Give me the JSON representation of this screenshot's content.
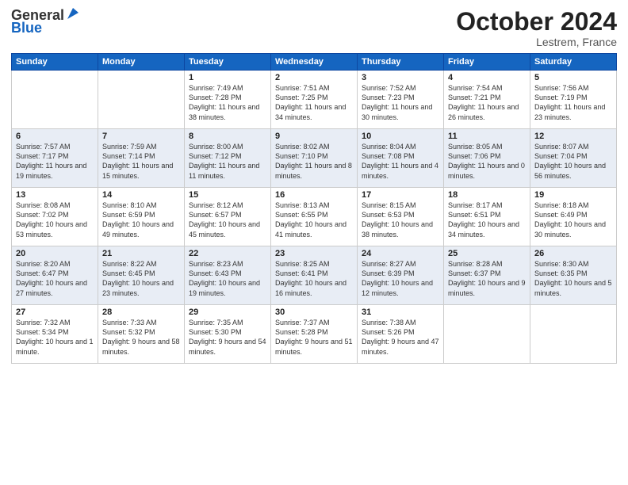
{
  "header": {
    "logo_general": "General",
    "logo_blue": "Blue",
    "month": "October 2024",
    "location": "Lestrem, France"
  },
  "days_of_week": [
    "Sunday",
    "Monday",
    "Tuesday",
    "Wednesday",
    "Thursday",
    "Friday",
    "Saturday"
  ],
  "weeks": [
    [
      {
        "day": "",
        "info": ""
      },
      {
        "day": "",
        "info": ""
      },
      {
        "day": "1",
        "info": "Sunrise: 7:49 AM\nSunset: 7:28 PM\nDaylight: 11 hours and 38 minutes."
      },
      {
        "day": "2",
        "info": "Sunrise: 7:51 AM\nSunset: 7:25 PM\nDaylight: 11 hours and 34 minutes."
      },
      {
        "day": "3",
        "info": "Sunrise: 7:52 AM\nSunset: 7:23 PM\nDaylight: 11 hours and 30 minutes."
      },
      {
        "day": "4",
        "info": "Sunrise: 7:54 AM\nSunset: 7:21 PM\nDaylight: 11 hours and 26 minutes."
      },
      {
        "day": "5",
        "info": "Sunrise: 7:56 AM\nSunset: 7:19 PM\nDaylight: 11 hours and 23 minutes."
      }
    ],
    [
      {
        "day": "6",
        "info": "Sunrise: 7:57 AM\nSunset: 7:17 PM\nDaylight: 11 hours and 19 minutes."
      },
      {
        "day": "7",
        "info": "Sunrise: 7:59 AM\nSunset: 7:14 PM\nDaylight: 11 hours and 15 minutes."
      },
      {
        "day": "8",
        "info": "Sunrise: 8:00 AM\nSunset: 7:12 PM\nDaylight: 11 hours and 11 minutes."
      },
      {
        "day": "9",
        "info": "Sunrise: 8:02 AM\nSunset: 7:10 PM\nDaylight: 11 hours and 8 minutes."
      },
      {
        "day": "10",
        "info": "Sunrise: 8:04 AM\nSunset: 7:08 PM\nDaylight: 11 hours and 4 minutes."
      },
      {
        "day": "11",
        "info": "Sunrise: 8:05 AM\nSunset: 7:06 PM\nDaylight: 11 hours and 0 minutes."
      },
      {
        "day": "12",
        "info": "Sunrise: 8:07 AM\nSunset: 7:04 PM\nDaylight: 10 hours and 56 minutes."
      }
    ],
    [
      {
        "day": "13",
        "info": "Sunrise: 8:08 AM\nSunset: 7:02 PM\nDaylight: 10 hours and 53 minutes."
      },
      {
        "day": "14",
        "info": "Sunrise: 8:10 AM\nSunset: 6:59 PM\nDaylight: 10 hours and 49 minutes."
      },
      {
        "day": "15",
        "info": "Sunrise: 8:12 AM\nSunset: 6:57 PM\nDaylight: 10 hours and 45 minutes."
      },
      {
        "day": "16",
        "info": "Sunrise: 8:13 AM\nSunset: 6:55 PM\nDaylight: 10 hours and 41 minutes."
      },
      {
        "day": "17",
        "info": "Sunrise: 8:15 AM\nSunset: 6:53 PM\nDaylight: 10 hours and 38 minutes."
      },
      {
        "day": "18",
        "info": "Sunrise: 8:17 AM\nSunset: 6:51 PM\nDaylight: 10 hours and 34 minutes."
      },
      {
        "day": "19",
        "info": "Sunrise: 8:18 AM\nSunset: 6:49 PM\nDaylight: 10 hours and 30 minutes."
      }
    ],
    [
      {
        "day": "20",
        "info": "Sunrise: 8:20 AM\nSunset: 6:47 PM\nDaylight: 10 hours and 27 minutes."
      },
      {
        "day": "21",
        "info": "Sunrise: 8:22 AM\nSunset: 6:45 PM\nDaylight: 10 hours and 23 minutes."
      },
      {
        "day": "22",
        "info": "Sunrise: 8:23 AM\nSunset: 6:43 PM\nDaylight: 10 hours and 19 minutes."
      },
      {
        "day": "23",
        "info": "Sunrise: 8:25 AM\nSunset: 6:41 PM\nDaylight: 10 hours and 16 minutes."
      },
      {
        "day": "24",
        "info": "Sunrise: 8:27 AM\nSunset: 6:39 PM\nDaylight: 10 hours and 12 minutes."
      },
      {
        "day": "25",
        "info": "Sunrise: 8:28 AM\nSunset: 6:37 PM\nDaylight: 10 hours and 9 minutes."
      },
      {
        "day": "26",
        "info": "Sunrise: 8:30 AM\nSunset: 6:35 PM\nDaylight: 10 hours and 5 minutes."
      }
    ],
    [
      {
        "day": "27",
        "info": "Sunrise: 7:32 AM\nSunset: 5:34 PM\nDaylight: 10 hours and 1 minute."
      },
      {
        "day": "28",
        "info": "Sunrise: 7:33 AM\nSunset: 5:32 PM\nDaylight: 9 hours and 58 minutes."
      },
      {
        "day": "29",
        "info": "Sunrise: 7:35 AM\nSunset: 5:30 PM\nDaylight: 9 hours and 54 minutes."
      },
      {
        "day": "30",
        "info": "Sunrise: 7:37 AM\nSunset: 5:28 PM\nDaylight: 9 hours and 51 minutes."
      },
      {
        "day": "31",
        "info": "Sunrise: 7:38 AM\nSunset: 5:26 PM\nDaylight: 9 hours and 47 minutes."
      },
      {
        "day": "",
        "info": ""
      },
      {
        "day": "",
        "info": ""
      }
    ]
  ]
}
